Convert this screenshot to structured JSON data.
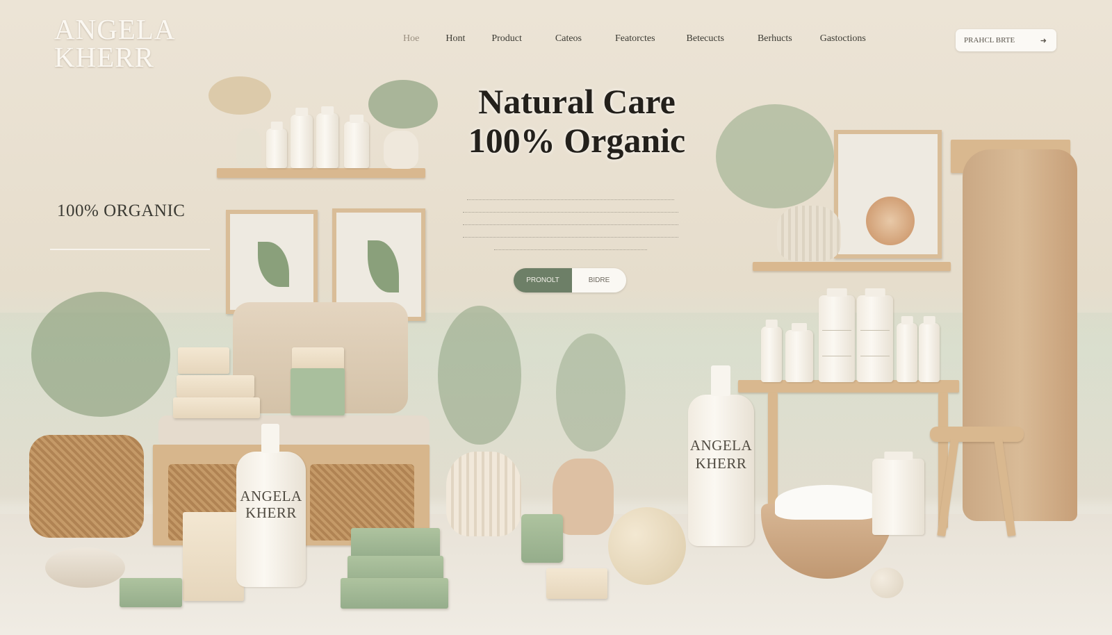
{
  "brand": {
    "line1": "ANGELA",
    "line2": "KHERR"
  },
  "nav": {
    "items": [
      "Hoe",
      "Hont",
      "Product",
      "Cateos",
      "Featorctes",
      "Betecucts",
      "Berhucts",
      "Gastoctions"
    ],
    "cta_label": "PRAHCL BRTE",
    "cta_icon": "arrow-right-icon"
  },
  "hero": {
    "title_line1": "Natural Care",
    "title_line2": "100% Organic",
    "body_lines": [
      "​",
      "​",
      "​",
      "​",
      "​"
    ],
    "button_primary": "PRONOLT",
    "button_secondary": "BIDRE"
  },
  "side_tag": "100% ORGANIC",
  "product_labels": {
    "pump_large_line1": "ANGELA",
    "pump_large_line2": "KHERR",
    "pump_small_line1": "ANGELA",
    "pump_small_line2": "KHERR"
  },
  "colors": {
    "background": "#e9e1d3",
    "accent_green": "#6d7f67",
    "wood": "#d9b88f",
    "text_dark": "#23201b"
  }
}
